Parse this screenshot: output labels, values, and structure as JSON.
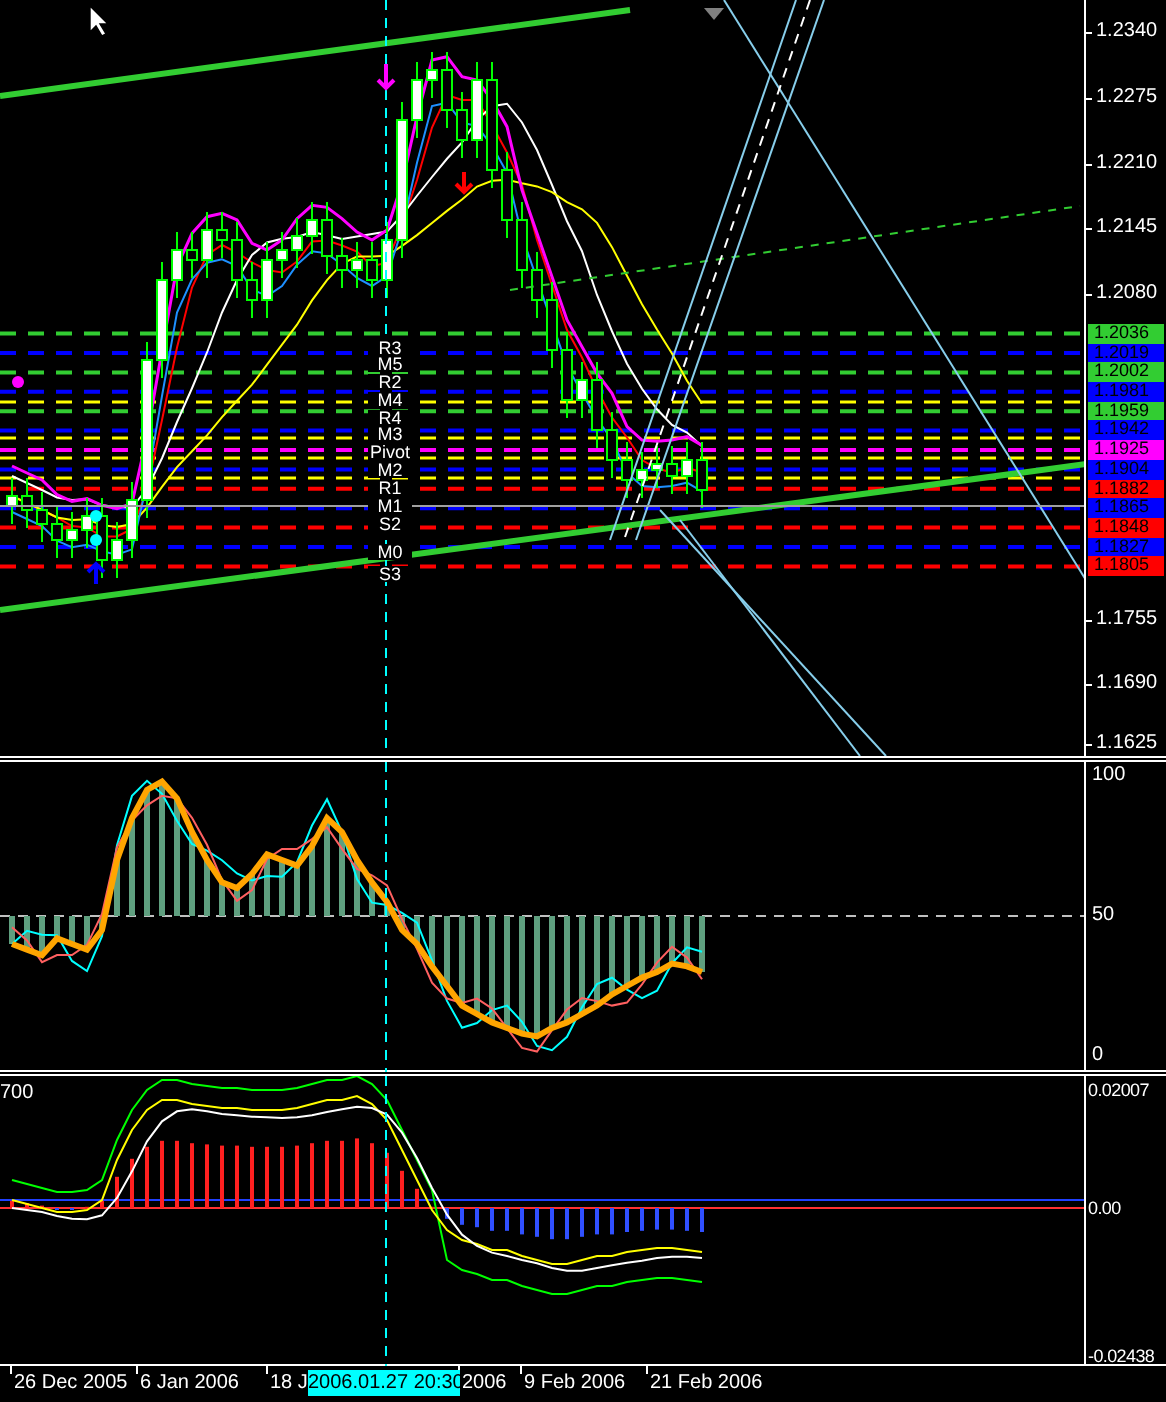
{
  "main_chart": {
    "price_axis": [
      "1.2340",
      "1.2275",
      "1.2210",
      "1.2145",
      "1.2080",
      "1.1755",
      "1.1690",
      "1.1625"
    ],
    "price_tags": [
      {
        "text": "1.2036",
        "color": "#32cd32"
      },
      {
        "text": "1.2019",
        "color": "#0000ff"
      },
      {
        "text": "1.2002",
        "color": "#32cd32"
      },
      {
        "text": "1.1981",
        "color": "#0000ff"
      },
      {
        "text": "1.1959",
        "color": "#32cd32"
      },
      {
        "text": "1.1942",
        "color": "#0000ff"
      },
      {
        "text": "1.1925",
        "color": "#ff00ff"
      },
      {
        "text": "1.1904",
        "color": "#0000ff"
      },
      {
        "text": "1.1882",
        "color": "#ff0000"
      },
      {
        "text": "1.1865",
        "color": "#0000ff"
      },
      {
        "text": "1.1848",
        "color": "#ff0000"
      },
      {
        "text": "1.1827",
        "color": "#0000ff"
      },
      {
        "text": "1.1805",
        "color": "#ff0000"
      }
    ],
    "pivot_labels": [
      "R3",
      "M5",
      "R2",
      "M4",
      "R4",
      "M3",
      "Pivot",
      "M2",
      "R1",
      "M1",
      "S2",
      "M0",
      "S3"
    ]
  },
  "oscillator": {
    "axis": [
      "100",
      "50",
      "0"
    ]
  },
  "macd": {
    "label": "700",
    "axis": [
      "0.02007",
      "0.00",
      "-0.02438"
    ]
  },
  "time_axis": {
    "labels": [
      "26 Dec 2005",
      "6 Jan 2006",
      "18 J",
      "2006",
      "9 Feb 2006",
      "21 Feb 2006"
    ],
    "crosshair_label": "2006.01.27 20:30"
  }
}
